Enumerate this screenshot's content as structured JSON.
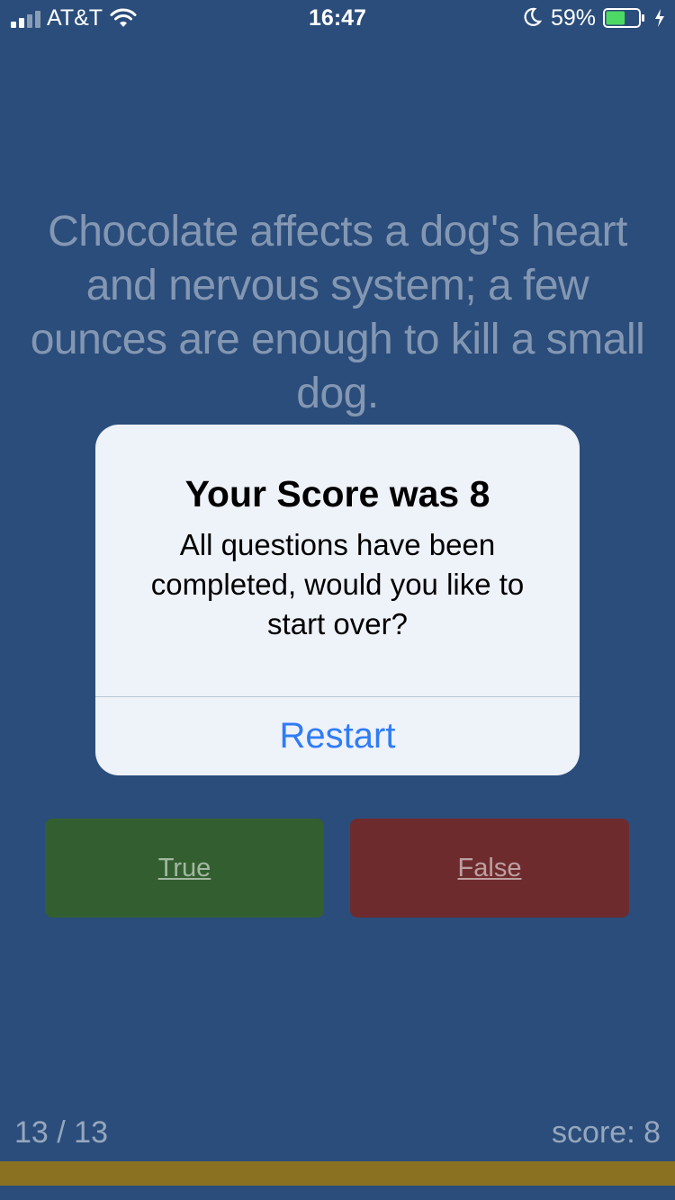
{
  "status_bar": {
    "carrier": "AT&T",
    "time": "16:47",
    "battery_percent": "59%",
    "battery_level": 0.59,
    "icons": [
      "signal-icon",
      "wifi-icon",
      "moon-icon",
      "battery-icon",
      "charging-icon"
    ]
  },
  "quiz": {
    "question": "Chocolate affects a dog's heart and nervous system; a few ounces are enough to kill a small dog.",
    "true_label": "True",
    "false_label": "False",
    "progress_text": "13 / 13",
    "score_text": "score: 8",
    "progress_fraction": 1.0
  },
  "alert": {
    "title": "Your Score was 8",
    "message": "All questions have been completed, would you like to start over?",
    "action_label": "Restart"
  },
  "colors": {
    "background": "#2b4d7b",
    "true_button": "#335f30",
    "false_button": "#6e2b2e",
    "progress_bar": "#8a7122",
    "alert_background": "#eef2f9",
    "alert_action": "#2f7cf6"
  }
}
